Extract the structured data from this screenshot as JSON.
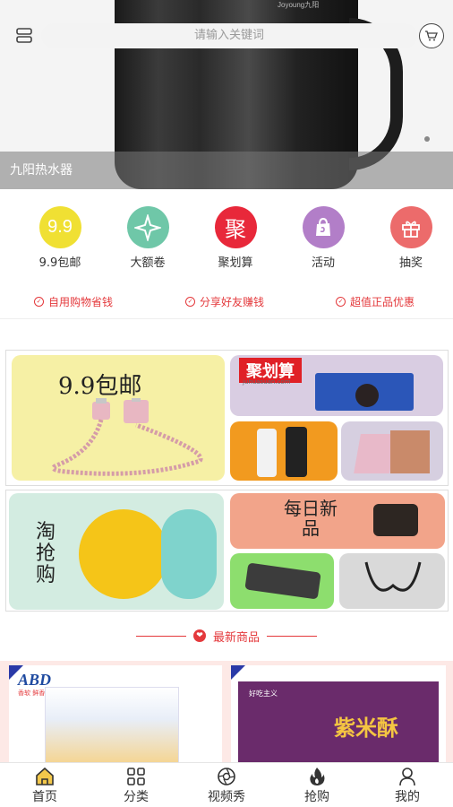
{
  "banner": {
    "caption": "九阳热水器",
    "brand": "Joyoung九阳"
  },
  "search": {
    "placeholder": "请输入关键词"
  },
  "categories": [
    {
      "label": "9.9包邮",
      "icon": "9.9",
      "color": "#f0e033",
      "icon_name": "nine-nine-icon"
    },
    {
      "label": "大额卷",
      "icon": "✦",
      "color": "#6fc7a8",
      "icon_name": "star-icon"
    },
    {
      "label": "聚划算",
      "icon": "聚",
      "color": "#e8283a",
      "icon_name": "ju-icon"
    },
    {
      "label": "活动",
      "icon": "🛍",
      "color": "#b27ec8",
      "icon_name": "shopping-bag-icon"
    },
    {
      "label": "抽奖",
      "icon": "🎁",
      "color": "#ec6b6b",
      "icon_name": "gift-icon"
    }
  ],
  "slogans": [
    "自用购物省钱",
    "分享好友赚钱",
    "超值正品优惠"
  ],
  "promo": {
    "top_left": "9.9包邮",
    "top_right": "聚划算",
    "top_right_sub": "juhuasuan.com",
    "bottom_left": "淘抢购",
    "bottom_right": "每日新品"
  },
  "section": {
    "title": "最新商品"
  },
  "products": [
    {
      "brand": "ABD",
      "subtitle": "香软 鲜香 美味"
    },
    {
      "brand": "紫米酥",
      "subtitle": "好吃主义"
    }
  ],
  "tabbar": [
    {
      "label": "首页",
      "icon_name": "home-icon"
    },
    {
      "label": "分类",
      "icon_name": "grid-icon"
    },
    {
      "label": "视频秀",
      "icon_name": "aperture-icon"
    },
    {
      "label": "抢购",
      "icon_name": "flame-icon"
    },
    {
      "label": "我的",
      "icon_name": "user-icon"
    }
  ],
  "colors": {
    "accent": "#e4393c"
  }
}
